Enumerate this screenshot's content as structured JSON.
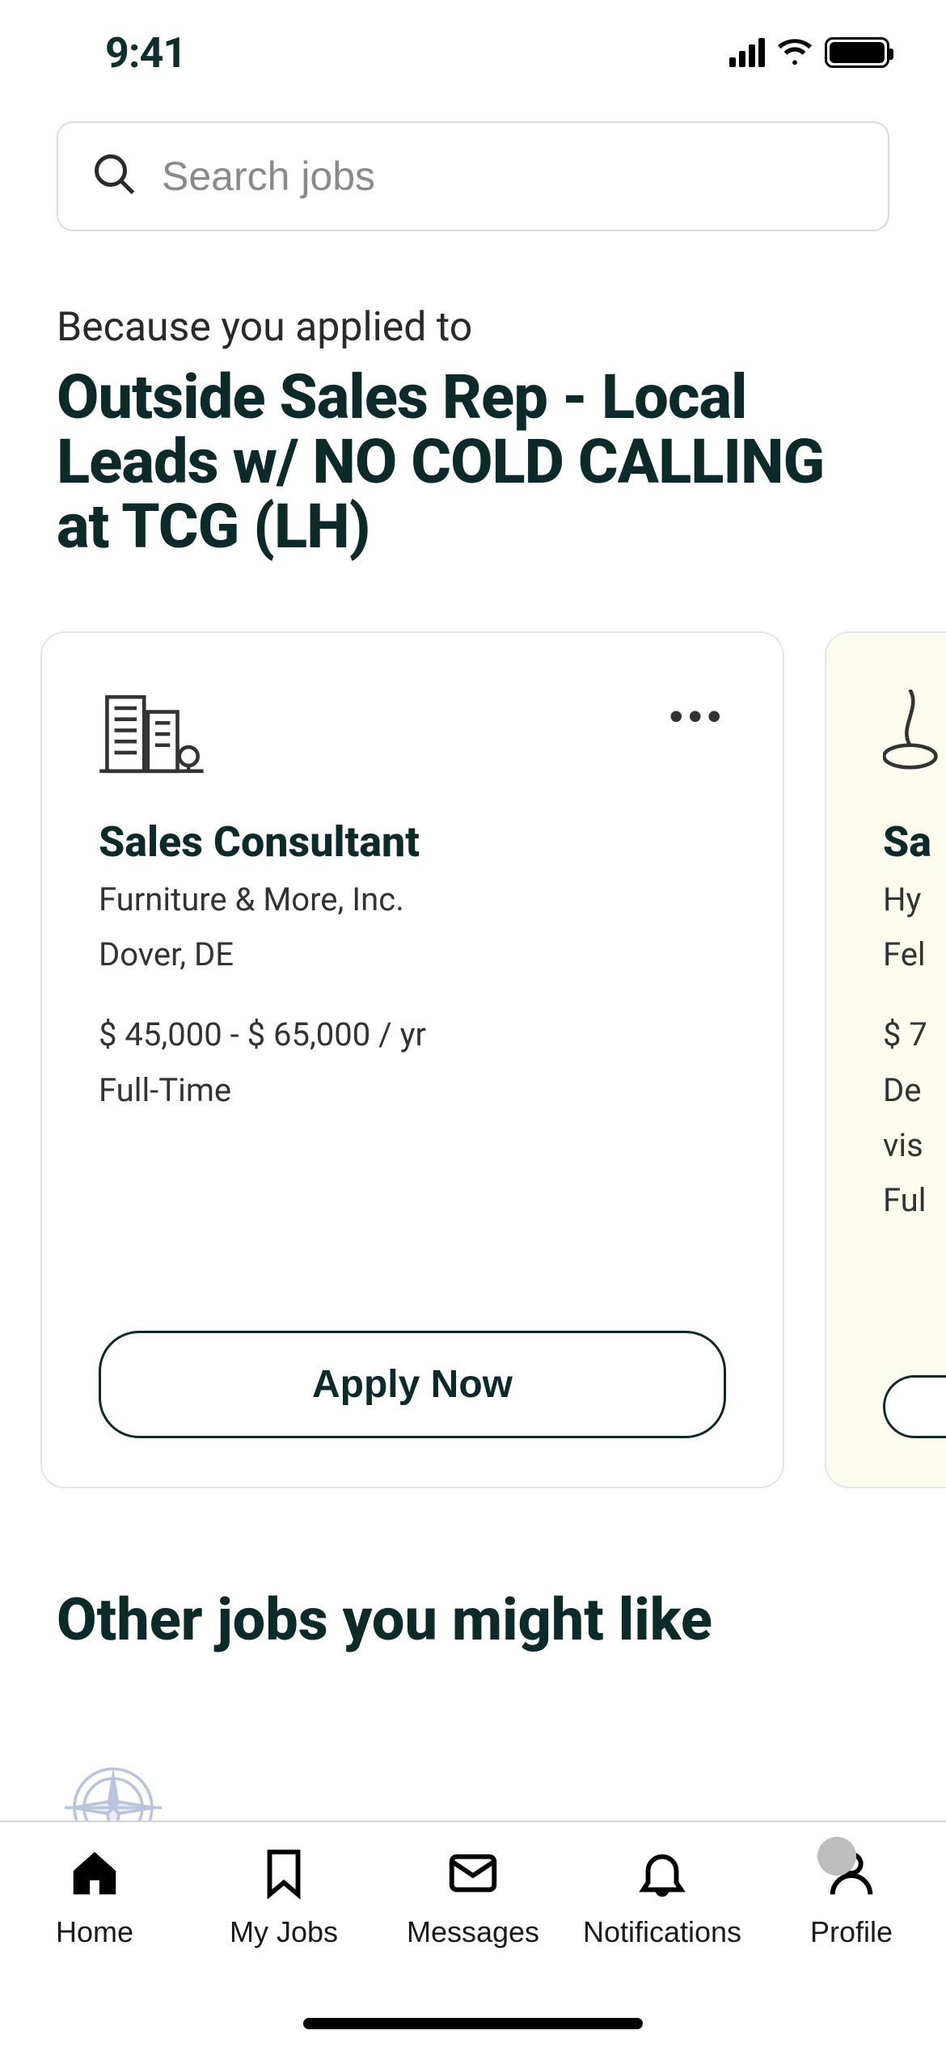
{
  "status": {
    "time": "9:41"
  },
  "search": {
    "placeholder": "Search jobs"
  },
  "heading": {
    "eyebrow": "Because you applied to",
    "title": "Outside Sales Rep - Local Leads w/ NO COLD CALLING at TCG (LH)"
  },
  "jobs": [
    {
      "title": "Sales Consultant",
      "company": "Furniture & More, Inc.",
      "location": "Dover, DE",
      "salary": "$ 45,000 - $ 65,000 / yr",
      "type": "Full-Time",
      "apply": "Apply Now"
    },
    {
      "title_prefix": "Sa",
      "company_prefix": "Hy",
      "location_prefix": "Fel",
      "salary_prefix": "$ 7",
      "line1": "De",
      "line2": "vis",
      "type": "Ful"
    }
  ],
  "section2": {
    "title": "Other jobs you might like"
  },
  "tabs": {
    "home": "Home",
    "myjobs": "My Jobs",
    "messages": "Messages",
    "notifications": "Notifications",
    "profile": "Profile"
  }
}
